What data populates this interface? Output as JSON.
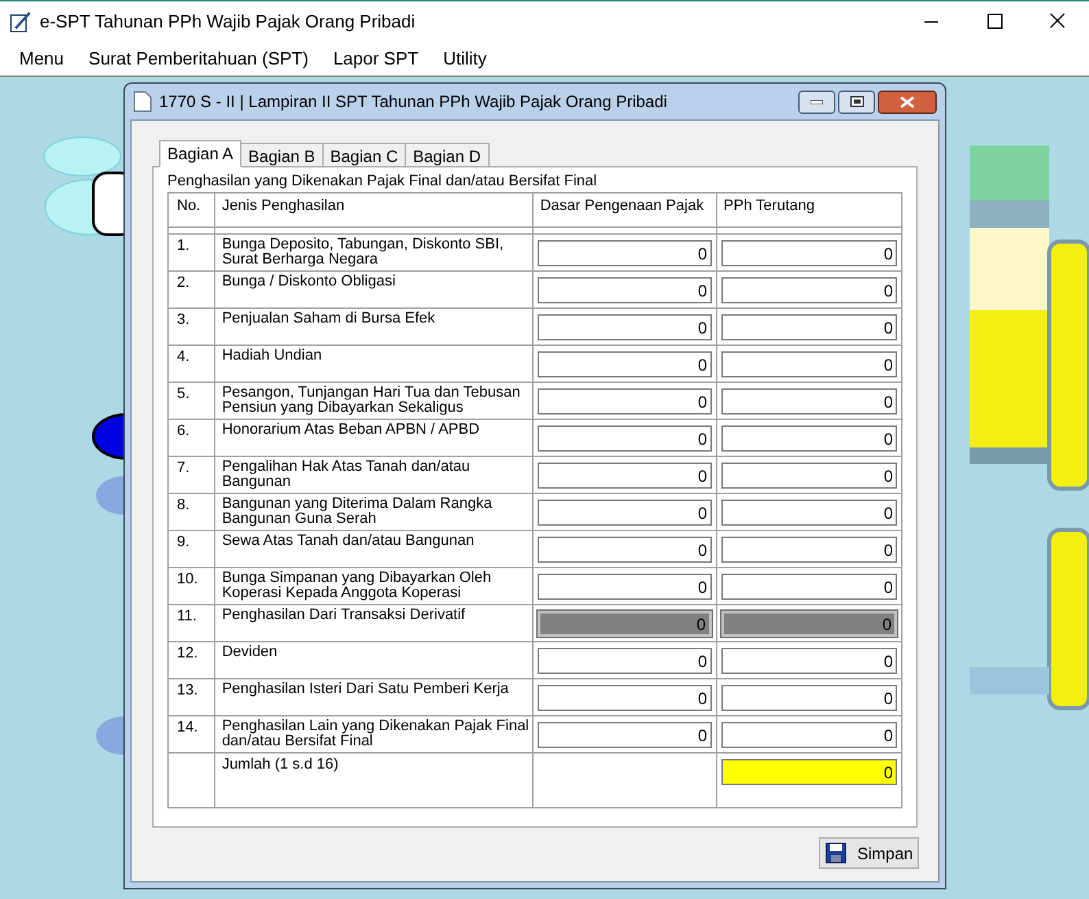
{
  "window": {
    "title": "e-SPT Tahunan PPh Wajib Pajak Orang Pribadi"
  },
  "menu": [
    {
      "label": "Menu"
    },
    {
      "label": "Surat Pemberitahuan (SPT)"
    },
    {
      "label": "Lapor SPT"
    },
    {
      "label": "Utility"
    }
  ],
  "dialog": {
    "title": "1770 S - II | Lampiran II SPT Tahunan PPh Wajib Pajak Orang Pribadi"
  },
  "tabs": [
    {
      "label": "Bagian A",
      "selected": true
    },
    {
      "label": "Bagian B",
      "selected": false
    },
    {
      "label": "Bagian C",
      "selected": false
    },
    {
      "label": "Bagian D",
      "selected": false
    }
  ],
  "section_title": "Penghasilan yang Dikenakan Pajak Final dan/atau Bersifat Final",
  "table": {
    "columns": [
      "No.",
      "Jenis Penghasilan",
      "Dasar Pengenaan Pajak",
      "PPh Terutang"
    ],
    "rows": [
      {
        "no": "1.",
        "jenis": "Bunga Deposito, Tabungan, Diskonto SBI, Surat Berharga Negara",
        "dasar": "0",
        "pph": "0",
        "disabled": false
      },
      {
        "no": "2.",
        "jenis": "Bunga / Diskonto Obligasi",
        "dasar": "0",
        "pph": "0",
        "disabled": false
      },
      {
        "no": "3.",
        "jenis": "Penjualan Saham di Bursa Efek",
        "dasar": "0",
        "pph": "0",
        "disabled": false
      },
      {
        "no": "4.",
        "jenis": "Hadiah Undian",
        "dasar": "0",
        "pph": "0",
        "disabled": false
      },
      {
        "no": "5.",
        "jenis": "Pesangon, Tunjangan Hari Tua dan Tebusan Pensiun yang Dibayarkan Sekaligus",
        "dasar": "0",
        "pph": "0",
        "disabled": false
      },
      {
        "no": "6.",
        "jenis": "Honorarium Atas Beban APBN / APBD",
        "dasar": "0",
        "pph": "0",
        "disabled": false
      },
      {
        "no": "7.",
        "jenis": "Pengalihan Hak Atas Tanah dan/atau Bangunan",
        "dasar": "0",
        "pph": "0",
        "disabled": false
      },
      {
        "no": "8.",
        "jenis": "Bangunan yang Diterima Dalam Rangka Bangunan Guna Serah",
        "dasar": "0",
        "pph": "0",
        "disabled": false
      },
      {
        "no": "9.",
        "jenis": "Sewa Atas Tanah dan/atau Bangunan",
        "dasar": "0",
        "pph": "0",
        "disabled": false
      },
      {
        "no": "10.",
        "jenis": "Bunga Simpanan yang Dibayarkan Oleh Koperasi Kepada Anggota Koperasi",
        "dasar": "0",
        "pph": "0",
        "disabled": false
      },
      {
        "no": "11.",
        "jenis": "Penghasilan Dari Transaksi Derivatif",
        "dasar": "0",
        "pph": "0",
        "disabled": true
      },
      {
        "no": "12.",
        "jenis": "Deviden",
        "dasar": "0",
        "pph": "0",
        "disabled": false
      },
      {
        "no": "13.",
        "jenis": "Penghasilan Isteri Dari Satu Pemberi Kerja",
        "dasar": "0",
        "pph": "0",
        "disabled": false
      },
      {
        "no": "14.",
        "jenis": "Penghasilan Lain yang Dikenakan Pajak Final dan/atau Bersifat Final",
        "dasar": "0",
        "pph": "0",
        "disabled": false
      }
    ],
    "total": {
      "label": "Jumlah (1 s.d 16)",
      "pph": "0"
    }
  },
  "buttons": [
    {
      "label": "Simpan"
    }
  ]
}
